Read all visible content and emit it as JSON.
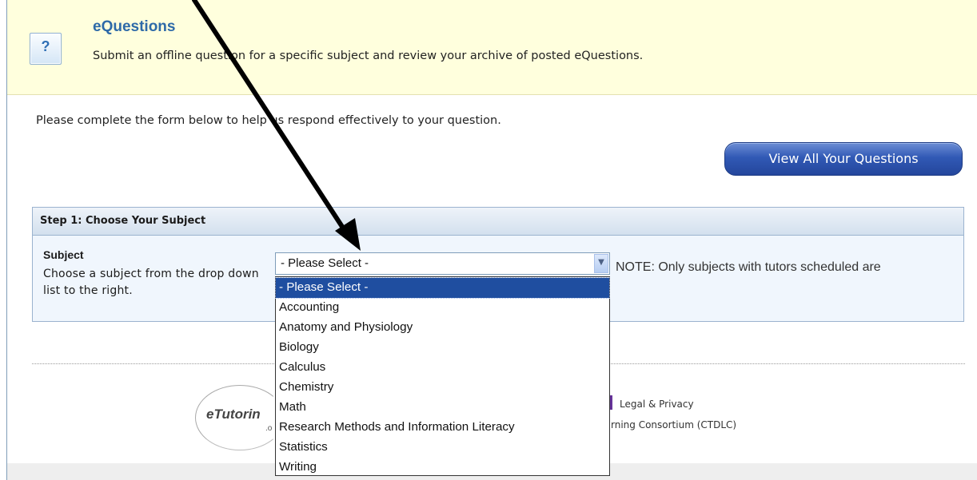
{
  "banner": {
    "icon": "question-icon",
    "icon_glyph": "?",
    "title": "eQuestions",
    "description": "Submit an offline question for a specific subject and review your archive of posted eQuestions."
  },
  "intro": "Please complete the form below to help us respond effectively to your question.",
  "view_button_label": "View All Your Questions",
  "step1": {
    "header": "Step 1: Choose Your Subject",
    "label": "Subject",
    "help": "Choose a subject from the drop down list to the right.",
    "select_value": "- Please Select -",
    "note": "NOTE: Only subjects with tutors scheduled are",
    "options": [
      "- Please Select -",
      "Accounting",
      "Anatomy and Physiology",
      "Biology",
      "Calculus",
      "Chemistry",
      "Math",
      "Research Methods and Information Literacy",
      "Statistics",
      "Writing"
    ]
  },
  "footer": {
    "logo_text": "eTutorin",
    "logo_sub": ".o",
    "legal_link": "Legal & Privacy",
    "consortium_text": "rning Consortium (CTDLC)"
  },
  "colors": {
    "banner_bg": "#ffffdd",
    "title_blue": "#2e6aa8",
    "button_blue": "#3159b5",
    "selected_option": "#1f4ea0"
  }
}
